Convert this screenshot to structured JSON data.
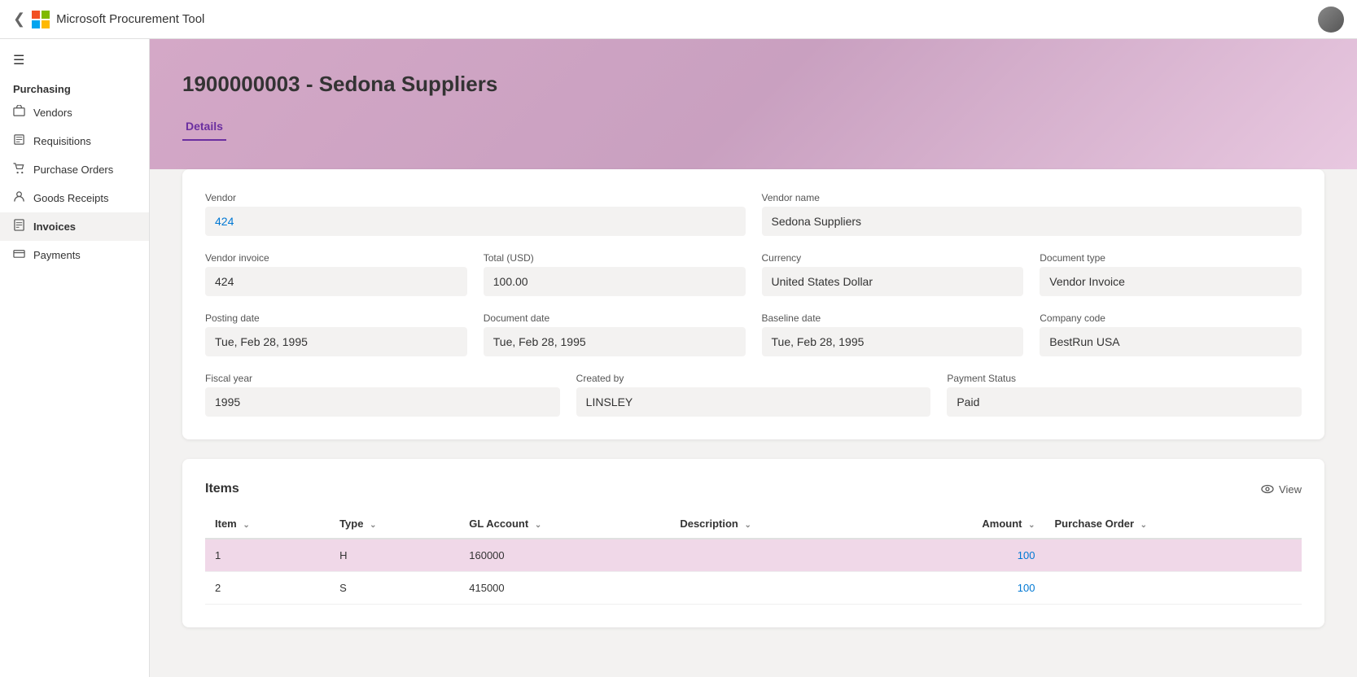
{
  "topbar": {
    "app_name": "Microsoft  Procurement Tool",
    "back_icon": "‹"
  },
  "sidebar": {
    "section": "Purchasing",
    "items": [
      {
        "id": "vendors",
        "label": "Vendors",
        "icon": "🏪",
        "active": false
      },
      {
        "id": "requisitions",
        "label": "Requisitions",
        "icon": "📋",
        "active": false
      },
      {
        "id": "purchase-orders",
        "label": "Purchase Orders",
        "icon": "🛒",
        "active": false
      },
      {
        "id": "goods-receipts",
        "label": "Goods Receipts",
        "icon": "👤",
        "active": false
      },
      {
        "id": "invoices",
        "label": "Invoices",
        "icon": "📄",
        "active": true
      },
      {
        "id": "payments",
        "label": "Payments",
        "icon": "💳",
        "active": false
      }
    ]
  },
  "page": {
    "title": "1900000003 - Sedona Suppliers"
  },
  "tabs": [
    {
      "id": "details",
      "label": "Details",
      "active": true
    }
  ],
  "details": {
    "vendor_label": "Vendor",
    "vendor_value": "424",
    "vendor_name_label": "Vendor name",
    "vendor_name_value": "Sedona Suppliers",
    "vendor_invoice_label": "Vendor invoice",
    "vendor_invoice_value": "424",
    "total_label": "Total (USD)",
    "total_value": "100.00",
    "currency_label": "Currency",
    "currency_value": "United States Dollar",
    "document_type_label": "Document type",
    "document_type_value": "Vendor Invoice",
    "posting_date_label": "Posting date",
    "posting_date_value": "Tue, Feb 28, 1995",
    "document_date_label": "Document date",
    "document_date_value": "Tue, Feb 28, 1995",
    "baseline_date_label": "Baseline date",
    "baseline_date_value": "Tue, Feb 28, 1995",
    "company_code_label": "Company code",
    "company_code_value": "BestRun USA",
    "fiscal_year_label": "Fiscal year",
    "fiscal_year_value": "1995",
    "created_by_label": "Created by",
    "created_by_value": "LINSLEY",
    "payment_status_label": "Payment Status",
    "payment_status_value": "Paid"
  },
  "items_section": {
    "title": "Items",
    "view_label": "View",
    "columns": [
      {
        "id": "item",
        "label": "Item"
      },
      {
        "id": "type",
        "label": "Type"
      },
      {
        "id": "gl_account",
        "label": "GL Account"
      },
      {
        "id": "description",
        "label": "Description"
      },
      {
        "id": "amount",
        "label": "Amount"
      },
      {
        "id": "purchase_order",
        "label": "Purchase Order"
      }
    ],
    "rows": [
      {
        "item": "1",
        "type": "H",
        "gl_account": "160000",
        "description": "",
        "amount": "100",
        "purchase_order": "",
        "highlighted": true
      },
      {
        "item": "2",
        "type": "S",
        "gl_account": "415000",
        "description": "",
        "amount": "100",
        "purchase_order": "",
        "highlighted": false
      }
    ]
  },
  "icons": {
    "back": "❮",
    "hamburger": "☰",
    "eye": "👁",
    "sort": "⌄"
  }
}
